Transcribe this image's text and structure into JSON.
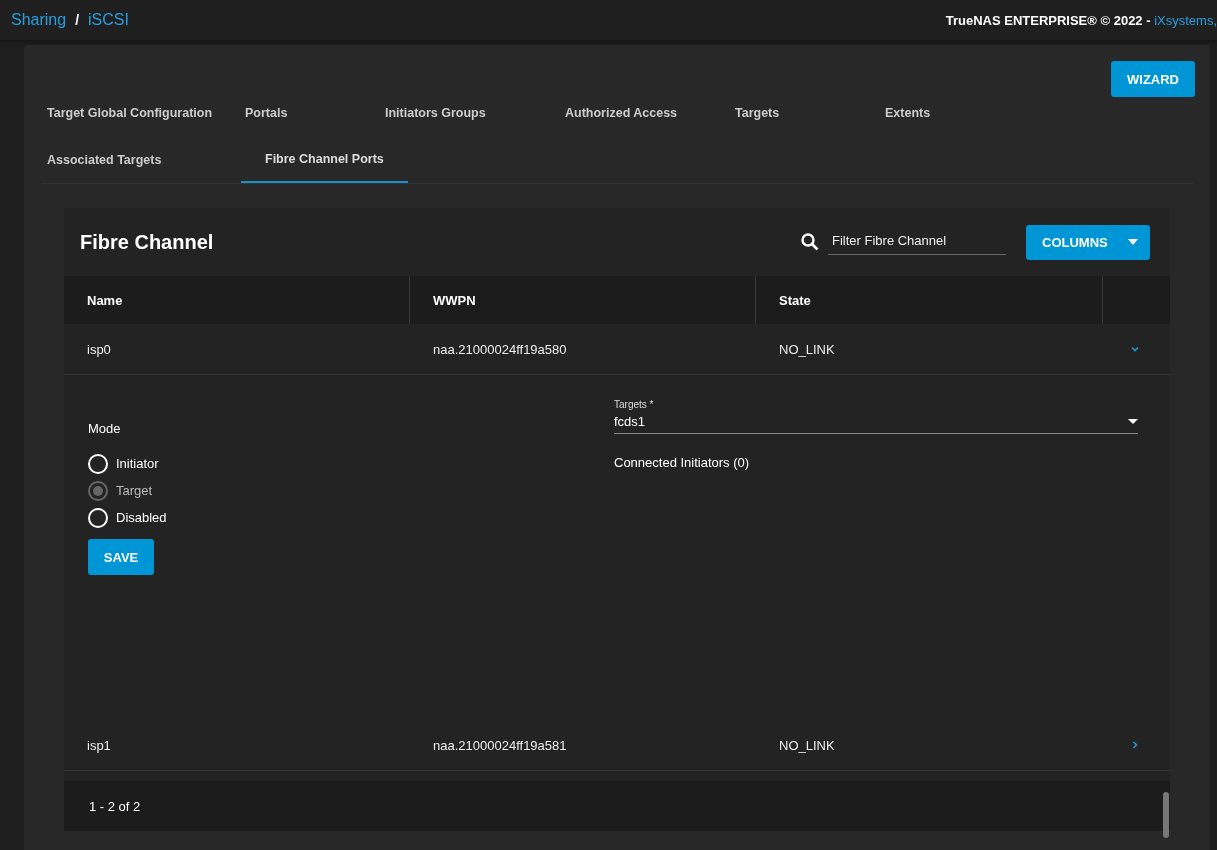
{
  "breadcrumb": [
    {
      "label": "Sharing"
    },
    {
      "label": "iSCSI"
    }
  ],
  "breadcrumb_separator": "/",
  "copyright": {
    "text": "TrueNAS ENTERPRISE® © 2022 - ",
    "link": "iXsystems,"
  },
  "wizard_button": "WIZARD",
  "tabs": [
    {
      "label": "Target Global Configuration",
      "selected": false
    },
    {
      "label": "Portals",
      "selected": false
    },
    {
      "label": "Initiators Groups",
      "selected": false
    },
    {
      "label": "Authorized Access",
      "selected": false
    },
    {
      "label": "Targets",
      "selected": false
    },
    {
      "label": "Extents",
      "selected": false
    },
    {
      "label": "Associated Targets",
      "selected": false
    },
    {
      "label": "Fibre Channel Ports",
      "selected": true
    }
  ],
  "table": {
    "title": "Fibre Channel",
    "filter": {
      "placeholder": "Filter Fibre Channel"
    },
    "columns_button": "COLUMNS",
    "columns": [
      "Name",
      "WWPN",
      "State"
    ],
    "rows": [
      {
        "cells": [
          "isp0",
          "naa.21000024ff19a580",
          "NO_LINK"
        ],
        "expanded": true
      },
      {
        "cells": [
          "isp1",
          "naa.21000024ff19a581",
          "NO_LINK"
        ],
        "expanded": false
      }
    ],
    "detail": {
      "mode_label": "Mode",
      "modes": [
        {
          "label": "Initiator",
          "selected": false,
          "disabled": false
        },
        {
          "label": "Target",
          "selected": true,
          "disabled": true
        },
        {
          "label": "Disabled",
          "selected": false,
          "disabled": false
        }
      ],
      "save": "SAVE",
      "targets_label": "Targets *",
      "targets_value": "fcds1",
      "connected": "Connected Initiators (0)"
    },
    "pager": "1 - 2 of 2"
  }
}
